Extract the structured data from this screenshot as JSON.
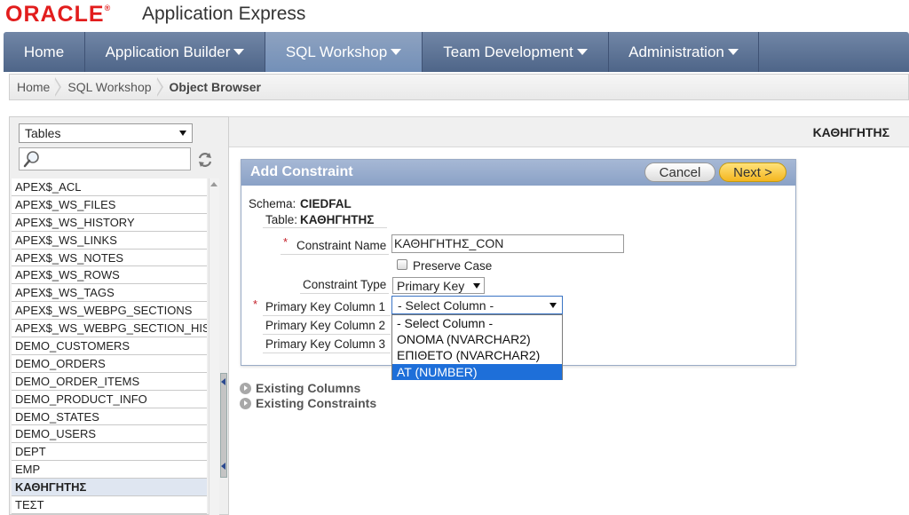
{
  "header": {
    "logo": "ORACLE",
    "logo_mark": "®",
    "product": "Application Express"
  },
  "nav": {
    "tabs": [
      {
        "label": "Home",
        "dropdown": false,
        "active": false
      },
      {
        "label": "Application Builder",
        "dropdown": true,
        "active": false
      },
      {
        "label": "SQL Workshop",
        "dropdown": true,
        "active": true
      },
      {
        "label": "Team Development",
        "dropdown": true,
        "active": false
      },
      {
        "label": "Administration",
        "dropdown": true,
        "active": false
      }
    ]
  },
  "breadcrumb": {
    "items": [
      "Home",
      "SQL Workshop"
    ],
    "current": "Object Browser"
  },
  "sidebar": {
    "object_type": "Tables",
    "search_placeholder": "",
    "objects": [
      "APEX$_ACL",
      "APEX$_WS_FILES",
      "APEX$_WS_HISTORY",
      "APEX$_WS_LINKS",
      "APEX$_WS_NOTES",
      "APEX$_WS_ROWS",
      "APEX$_WS_TAGS",
      "APEX$_WS_WEBPG_SECTIONS",
      "APEX$_WS_WEBPG_SECTION_HIS",
      "DEMO_CUSTOMERS",
      "DEMO_ORDERS",
      "DEMO_ORDER_ITEMS",
      "DEMO_PRODUCT_INFO",
      "DEMO_STATES",
      "DEMO_USERS",
      "DEPT",
      "EMP",
      "ΚΑΘΗΓΗΤΗΣ",
      "ΤΕΣΤ"
    ],
    "selected": "ΚΑΘΗΓΗΤΗΣ"
  },
  "object_title": "ΚΑΘΗΓΗΤΗΣ",
  "dialog": {
    "title": "Add Constraint",
    "cancel_label": "Cancel",
    "next_label": "Next >",
    "schema_label": "Schema:",
    "schema_value": "CIEDFAL",
    "table_label": "Table:",
    "table_value": "ΚΑΘΗΓΗΤΗΣ",
    "constraint_name_label": "Constraint Name",
    "constraint_name_value": "ΚΑΘΗΓΗΤΗΣ_CON",
    "preserve_case_label": "Preserve Case",
    "preserve_case_checked": false,
    "constraint_type_label": "Constraint Type",
    "constraint_type_value": "Primary Key",
    "pk1_label": "Primary Key Column 1",
    "pk1_value": "- Select Column -",
    "pk2_label": "Primary Key Column 2",
    "pk3_label": "Primary Key Column 3",
    "pk_options": [
      "- Select Column -",
      "ONOMA (NVARCHAR2)",
      "ΕΠΙΘΕΤΟ (NVARCHAR2)",
      "AT (NUMBER)"
    ],
    "pk_highlighted": "AT (NUMBER)",
    "required_mark": "*"
  },
  "sections": {
    "existing_columns": "Existing Columns",
    "existing_constraints": "Existing Constraints"
  },
  "colors": {
    "brand_red": "#e21d1d",
    "nav_blue": "#4e6588",
    "highlight_blue": "#1e6fd9",
    "next_button": "#f4b620"
  }
}
